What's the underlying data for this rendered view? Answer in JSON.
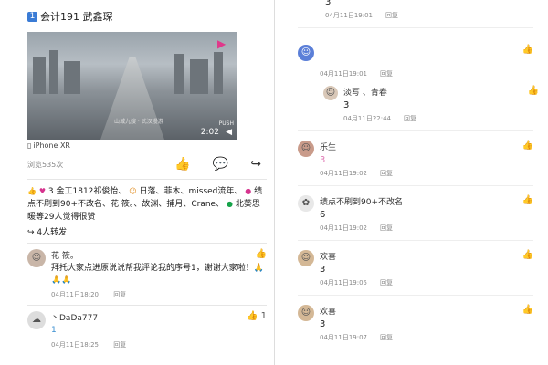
{
  "post": {
    "number_badge": "1",
    "title": "会计191 武鑫琛",
    "video": {
      "time": "2:02",
      "brand": "PUSH",
      "watermark": "山城九嫂 · 武汉漫游"
    },
    "device": "iPhone XR",
    "views": "浏览535次",
    "likes_text_1": "3",
    "likes_names": "金工1812祁俊怡、",
    "likes_names_2": "日落、菲木、missed流年、",
    "likes_names_3": "绩点不刷到90+不改名、花 筱。、故渊、捕月、Crane、",
    "likes_names_4": "北葵思暖等29人觉得很赞",
    "shares": "4人转发"
  },
  "left_comments": [
    {
      "name": "花 筱。",
      "text": "拜托大家点进原说说帮我评论我的序号1，谢谢大家啦！🙏🙏🙏",
      "time": "04月11日18:20",
      "reply": "回复",
      "like_count": ""
    },
    {
      "name": "丶DaDa777",
      "text": "1",
      "time": "04月11日18:25",
      "reply": "回复",
      "like_count": "1"
    }
  ],
  "right_comments": [
    {
      "name": "",
      "text": "3",
      "time": "04月11日19:01",
      "reply": "回复"
    },
    {
      "name": "",
      "text": "",
      "time": "04月11日19:01",
      "reply": "回复"
    },
    {
      "name": "淡写 、青春",
      "text": "3",
      "time": "04月11日22:44",
      "reply": "回复"
    },
    {
      "name": "乐生",
      "text": "3",
      "time": "04月11日19:02",
      "reply": "回复"
    },
    {
      "name": "绩点不刷到90+不改名",
      "text": "6",
      "time": "04月11日19:02",
      "reply": "回复"
    },
    {
      "name": "欢喜",
      "text": "3",
      "time": "04月11日19:05",
      "reply": "回复"
    },
    {
      "name": "欢喜",
      "text": "3",
      "time": "04月11日19:07",
      "reply": "回复"
    }
  ]
}
